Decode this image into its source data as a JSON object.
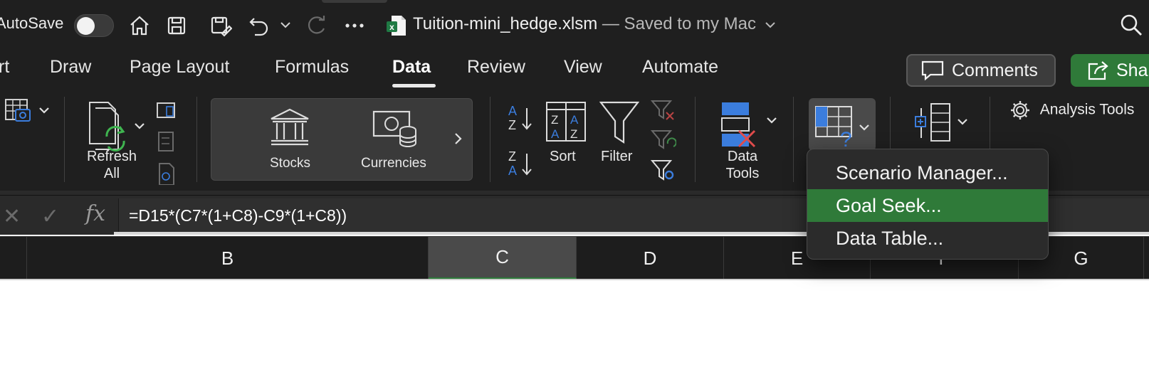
{
  "titlebar": {
    "autosave_label": "AutoSave",
    "autosave_on": false,
    "doc_name": "Tuition-mini_hedge.xlsm",
    "doc_status": " — Saved to my Mac",
    "status_chevron": "⌄",
    "icons": [
      "home-icon",
      "save-icon",
      "save-as-icon",
      "undo-icon",
      "redo-icon",
      "more-icon",
      "excel-file-icon",
      "search-icon"
    ]
  },
  "tabs": {
    "items": [
      "rt",
      "Draw",
      "Page Layout",
      "Formulas",
      "Data",
      "Review",
      "View",
      "Automate"
    ],
    "active": "Data",
    "comments_label": "Comments",
    "share_label": "Shar"
  },
  "ribbon": {
    "refresh_all": "Refresh\nAll",
    "refresh_line1": "Refresh",
    "refresh_line2": "All",
    "stocks": "Stocks",
    "currencies": "Currencies",
    "sort": "Sort",
    "filter": "Filter",
    "data_tools_line1": "Data",
    "data_tools_line2": "Tools",
    "analysis_tools": "Analysis Tools",
    "sort_az_top": "A",
    "sort_az_bottom": "Z",
    "sort_za_top": "Z",
    "sort_za_bottom": "A"
  },
  "formula_bar": {
    "cancel_glyph": "✕",
    "enter_glyph": "✓",
    "fx_label": "fx",
    "formula": "=D15*(C7*(1+C8)-C9*(1+C8))"
  },
  "columns": [
    "B",
    "C",
    "D",
    "E",
    "F",
    "G"
  ],
  "selected_column": "C",
  "whatif_menu": {
    "items": [
      "Scenario Manager...",
      "Goal Seek...",
      "Data Table..."
    ],
    "highlighted": "Goal Seek..."
  },
  "colors": {
    "accent_green": "#2f7a39",
    "ribbon_bg": "#1f1f1f",
    "blue_icon": "#3b7ddd",
    "red_icon": "#e04b4b"
  }
}
